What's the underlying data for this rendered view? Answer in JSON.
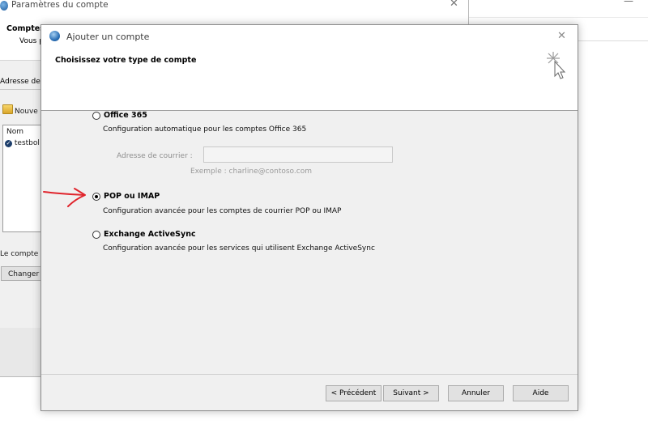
{
  "background_window": {
    "title": "Paramètres du compte",
    "heading": "Comptes",
    "subtext": "Vous p",
    "tab_label": "Adresse de",
    "new_label": "Nouve",
    "list_header": "Nom",
    "list_row": "testbol",
    "footer_text": "Le compte",
    "change_button": "Changer",
    "minimize_glyph": "—",
    "close_glyph": "✕"
  },
  "dialog": {
    "title": "Ajouter un compte",
    "heading": "Choisissez votre type de compte",
    "close_glyph": "✕",
    "options": [
      {
        "label": "Office 365",
        "description": "Configuration automatique pour les comptes Office 365",
        "checked": false
      },
      {
        "label": "POP ou IMAP",
        "description": "Configuration avancée pour les comptes de courrier POP ou IMAP",
        "checked": true
      },
      {
        "label": "Exchange ActiveSync",
        "description": "Configuration avancée pour les services qui utilisent Exchange ActiveSync",
        "checked": false
      }
    ],
    "email": {
      "label": "Adresse de courrier :",
      "value": "",
      "example": "Exemple : charline@contoso.com"
    },
    "buttons": {
      "back": "< Précédent",
      "next": "Suivant >",
      "cancel": "Annuler",
      "help": "Aide"
    }
  },
  "colors": {
    "annotation_arrow": "#e0242c",
    "dialog_background": "#f0f0f0"
  },
  "icons": [
    "outlook-icon",
    "close-icon",
    "new-account-icon",
    "check-circle-icon",
    "wizard-cursor-icon",
    "red-arrow-annotation"
  ]
}
